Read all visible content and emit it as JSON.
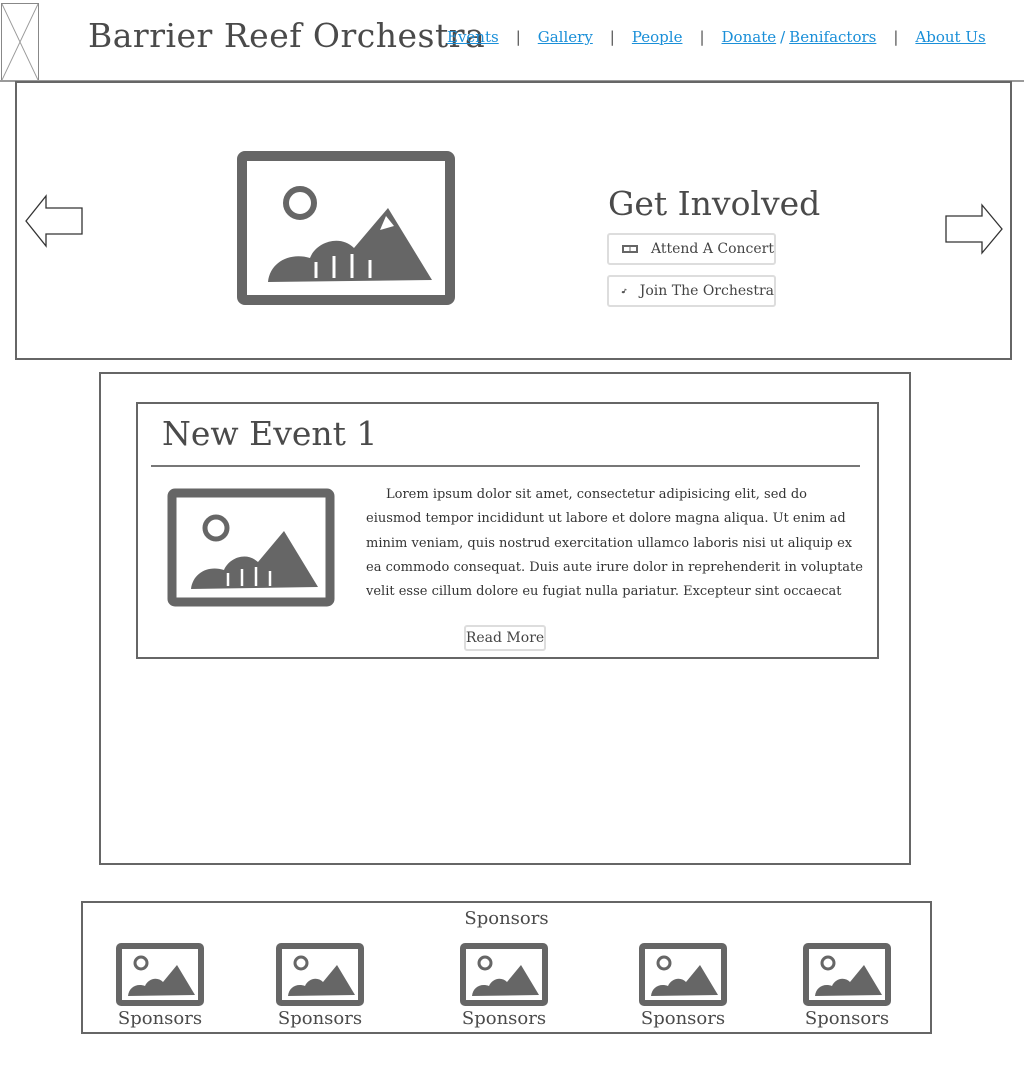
{
  "header": {
    "title": "Barrier Reef Orchestra",
    "logo_icon": "image-placeholder-icon",
    "nav": {
      "events": "Events",
      "gallery": "Gallery",
      "people": "People",
      "donate": "Donate",
      "slash": "/",
      "benefactors": "Benifactors",
      "about": "About Us",
      "separator": "|"
    },
    "link_color": "#1a8fd8"
  },
  "hero": {
    "left_arrow_icon": "arrow-left-icon",
    "right_arrow_icon": "arrow-right-icon",
    "image_icon": "image-placeholder-icon",
    "heading": "Get Involved",
    "attend_label": "Attend A Concert",
    "attend_icon": "ticket-icon",
    "join_label": "Join The Orchestra",
    "join_icon": "music-note-icon"
  },
  "events": {
    "card_title": "New Event 1",
    "image_icon": "image-placeholder-icon",
    "body": "Lorem ipsum dolor sit amet, consectetur adipisicing elit, sed do eiusmod tempor incididunt ut labore et dolore magna aliqua. Ut enim ad minim veniam, quis nostrud exercitation ullamco laboris nisi ut aliquip ex ea commodo consequat. Duis aute irure dolor in reprehenderit in voluptate velit esse cillum dolore eu fugiat nulla pariatur. Excepteur sint occaecat cupidatat non proident, sunt in culpa qui officia deserunt mollit anim id est laborum.",
    "read_more": "Read More"
  },
  "sponsors": {
    "title": "Sponsors",
    "items": [
      {
        "label": "Sponsors",
        "icon": "image-placeholder-icon"
      },
      {
        "label": "Sponsors",
        "icon": "image-placeholder-icon"
      },
      {
        "label": "Sponsors",
        "icon": "image-placeholder-icon"
      },
      {
        "label": "Sponsors",
        "icon": "image-placeholder-icon"
      },
      {
        "label": "Sponsors",
        "icon": "image-placeholder-icon"
      }
    ]
  }
}
